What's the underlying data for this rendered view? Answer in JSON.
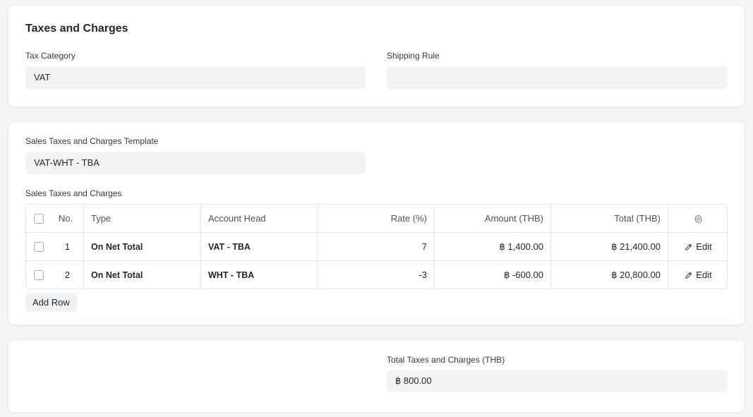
{
  "taxes_section": {
    "title": "Taxes and Charges",
    "tax_category": {
      "label": "Tax Category",
      "value": "VAT"
    },
    "shipping_rule": {
      "label": "Shipping Rule",
      "value": ""
    }
  },
  "template_section": {
    "template": {
      "label": "Sales Taxes and Charges Template",
      "value": "VAT-WHT - TBA"
    },
    "table_label": "Sales Taxes and Charges",
    "table": {
      "headers": {
        "no": "No.",
        "type": "Type",
        "account_head": "Account Head",
        "rate": "Rate (%)",
        "amount": "Amount (THB)",
        "total": "Total (THB)"
      },
      "rows": [
        {
          "no": "1",
          "type": "On Net Total",
          "account_head": "VAT - TBA",
          "rate": "7",
          "amount": "฿ 1,400.00",
          "total": "฿ 21,400.00",
          "action": "Edit"
        },
        {
          "no": "2",
          "type": "On Net Total",
          "account_head": "WHT - TBA",
          "rate": "-3",
          "amount": "฿ -600.00",
          "total": "฿ 20,800.00",
          "action": "Edit"
        }
      ]
    },
    "add_row_label": "Add Row"
  },
  "totals_section": {
    "total_taxes": {
      "label": "Total Taxes and Charges (THB)",
      "value": "฿ 800.00"
    }
  }
}
